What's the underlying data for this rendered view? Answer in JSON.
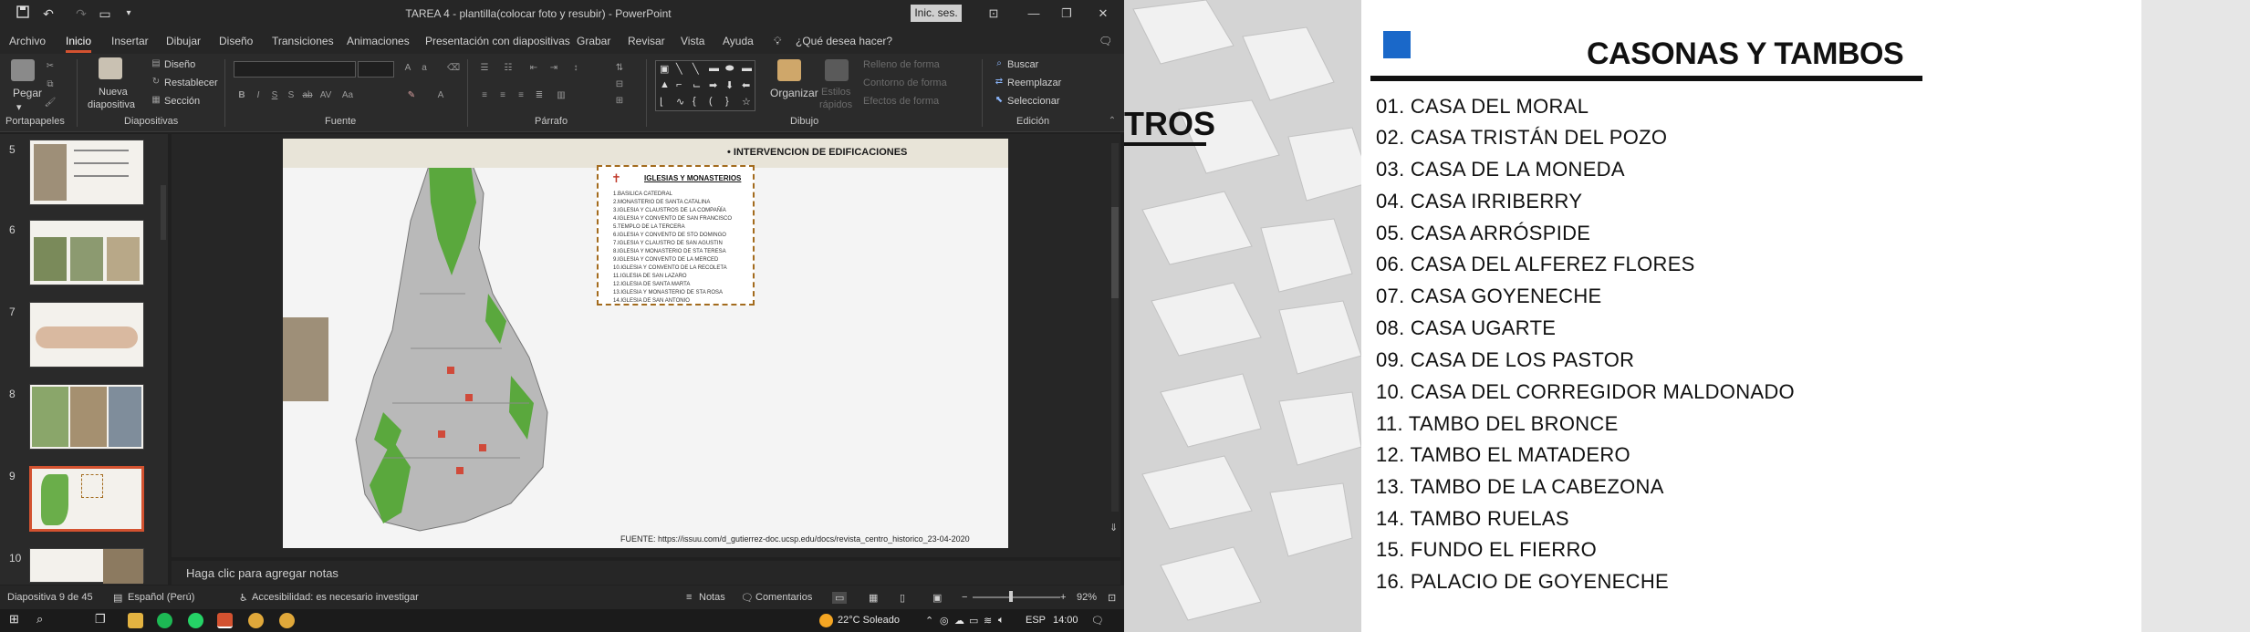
{
  "app": {
    "title": "TAREA 4 - plantilla(colocar foto y resubir) - PowerPoint",
    "sign_in": "Inic. ses."
  },
  "menu": {
    "tabs": [
      "Archivo",
      "Inicio",
      "Insertar",
      "Dibujar",
      "Diseño",
      "Transiciones",
      "Animaciones",
      "Presentación con diapositivas",
      "Grabar",
      "Revisar",
      "Vista",
      "Ayuda"
    ],
    "active": "Inicio",
    "tell_me": "¿Qué desea hacer?"
  },
  "ribbon": {
    "clipboard": {
      "paste": "Pegar",
      "label": "Portapapeles"
    },
    "slides": {
      "new_slide": "Nueva",
      "new_slide2": "diapositiva",
      "layout": "Diseño",
      "reset": "Restablecer",
      "section": "Sección",
      "label": "Diapositivas"
    },
    "font": {
      "label": "Fuente"
    },
    "paragraph": {
      "label": "Párrafo"
    },
    "drawing": {
      "arrange": "Organizar",
      "quick_styles": "Estilos",
      "quick_styles2": "rápidos",
      "shape_fill": "Relleno de forma",
      "shape_outline": "Contorno de forma",
      "shape_effects": "Efectos de forma",
      "label": "Dibujo"
    },
    "editing": {
      "find": "Buscar",
      "replace": "Reemplazar",
      "select": "Seleccionar",
      "label": "Edición"
    }
  },
  "thumbnails": {
    "numbers": [
      "5",
      "6",
      "7",
      "8",
      "9",
      "10"
    ],
    "selected": "9"
  },
  "slide": {
    "header": "•  INTERVENCION DE EDIFICACIONES",
    "legend_title": "IGLESIAS Y MONASTERIOS",
    "legend_items": [
      "1.BASILICA CATEDRAL",
      "2.MONASTERIO DE SANTA CATALINA",
      "3.IGLESIA Y CLAUSTROS DE LA COMPAÑÍA",
      "4.IGLESIA Y CONVENTO DE SAN FRANCISCO",
      "5.TEMPLO DE LA TERCERA",
      "6.IGLESIA Y CONVENTO DE STO DOMINGO",
      "7.IGLESIA Y CLAUSTRO DE SAN AGUSTIN",
      "8.IGLESIA Y MONASTERIO DE STA TERESA",
      "9.IGLESIA Y CONVENTO DE LA MERCED",
      "10.IGLESIA Y CONVENTO DE LA RECOLETA",
      "11.IGLESIA DE SAN LAZARO",
      "12.IGLESIA DE SANTA MARTA",
      "13.IGLESIA Y MONASTERIO DE STA ROSA",
      "14.IGLESIA DE SAN ANTONIO"
    ],
    "source": "FUENTE: https://issuu.com/d_gutierrez-doc.ucsp.edu/docs/revista_centro_historico_23-04-2020"
  },
  "notes": {
    "placeholder": "Haga clic para agregar notas"
  },
  "status": {
    "slide_count": "Diapositiva 9 de 45",
    "language": "Español (Perú)",
    "accessibility": "Accesibilidad: es necesario investigar",
    "notes": "Notas",
    "comments": "Comentarios",
    "zoom": "92%",
    "zoom_minus": "−",
    "zoom_plus": "+"
  },
  "taskbar": {
    "weather": "22°C  Soleado",
    "lang": "ESP",
    "time": "14:00"
  },
  "right_panel": {
    "heading": "CASONAS Y TAMBOS",
    "partial_heading": "TROS",
    "items": [
      "01. CASA DEL MORAL",
      "02. CASA TRISTÁN DEL POZO",
      "03. CASA DE LA MONEDA",
      "04. CASA IRRIBERRY",
      "05. CASA ARRÓSPIDE",
      "06. CASA DEL ALFEREZ FLORES",
      "07. CASA GOYENECHE",
      "08. CASA UGARTE",
      "09. CASA DE LOS PASTOR",
      "10. CASA DEL CORREGIDOR MALDONADO",
      "11. TAMBO DEL BRONCE",
      "12. TAMBO EL MATADERO",
      "13. TAMBO DE LA CABEZONA",
      "14. TAMBO RUELAS",
      "15. FUNDO EL FIERRO",
      "16. PALACIO DE GOYENECHE"
    ]
  },
  "colors": {
    "accent": "#d35230",
    "legend_border": "#a36b1d",
    "map_green": "#5aa83d",
    "marker_blue": "#1a68c9"
  }
}
